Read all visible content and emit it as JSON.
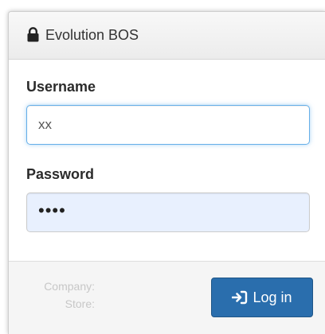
{
  "header": {
    "title": "Evolution BOS",
    "icon": "lock-icon"
  },
  "form": {
    "username": {
      "label": "Username",
      "value": "xx"
    },
    "password": {
      "label": "Password",
      "value": "••••"
    }
  },
  "footer": {
    "company_label": "Company:",
    "store_label": "Store:",
    "login_label": "Log in",
    "login_icon": "sign-in-icon"
  },
  "colors": {
    "accent": "#2a6ead",
    "focus_border": "#66afe9",
    "autofill_bg": "#e8f0fe"
  }
}
